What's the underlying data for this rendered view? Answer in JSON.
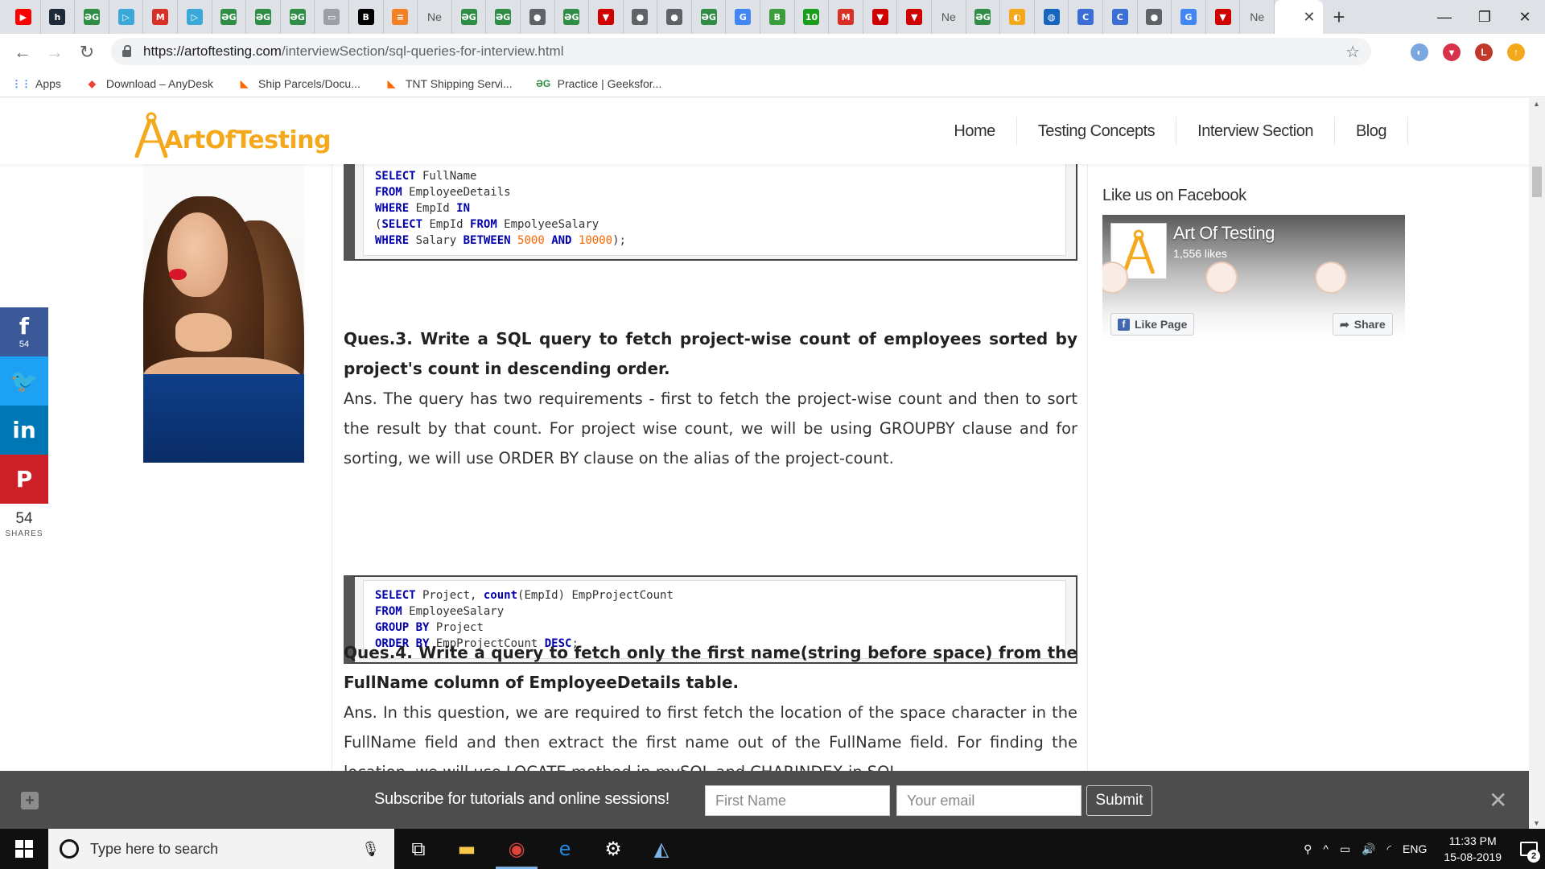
{
  "browser": {
    "tabs": [
      {
        "icon": "youtube-icon",
        "glyph": "▶",
        "color": "#ff0000"
      },
      {
        "icon": "hackerrank-icon",
        "glyph": "h",
        "color": "#1d2a3a"
      },
      {
        "icon": "geeksforgeeks-icon",
        "glyph": "ƏG",
        "color": "#2f8d46"
      },
      {
        "icon": "media-icon",
        "glyph": "▷",
        "color": "#3aa8d8"
      },
      {
        "icon": "gmail-icon",
        "glyph": "M",
        "color": "#d93025"
      },
      {
        "icon": "media-icon",
        "glyph": "▷",
        "color": "#3aa8d8"
      },
      {
        "icon": "geeksforgeeks-icon",
        "glyph": "ƏG",
        "color": "#2f8d46"
      },
      {
        "icon": "geeksforgeeks-icon",
        "glyph": "ƏG",
        "color": "#2f8d46"
      },
      {
        "icon": "geeksforgeeks-icon",
        "glyph": "ƏG",
        "color": "#2f8d46"
      },
      {
        "icon": "image-icon",
        "glyph": "▭",
        "color": "#9aa0a6"
      },
      {
        "icon": "bold-b-icon",
        "glyph": "B",
        "color": "#000000"
      },
      {
        "icon": "stackoverflow-icon",
        "glyph": "≡",
        "color": "#f48024"
      },
      {
        "icon": "new-tab-icon",
        "text": "Ne"
      },
      {
        "icon": "geeksforgeeks-icon",
        "glyph": "ƏG",
        "color": "#2f8d46"
      },
      {
        "icon": "geeksforgeeks-icon",
        "glyph": "ƏG",
        "color": "#2f8d46"
      },
      {
        "icon": "globe-icon",
        "glyph": "●",
        "color": "#5f6368"
      },
      {
        "icon": "geeksforgeeks-icon",
        "glyph": "ƏG",
        "color": "#2f8d46"
      },
      {
        "icon": "vivaldi-icon",
        "glyph": "▼",
        "color": "#d00000"
      },
      {
        "icon": "globe-icon",
        "glyph": "●",
        "color": "#5f6368"
      },
      {
        "icon": "globe-icon",
        "glyph": "●",
        "color": "#5f6368"
      },
      {
        "icon": "geeksforgeeks-icon",
        "glyph": "ƏG",
        "color": "#2f8d46"
      },
      {
        "icon": "google-icon",
        "glyph": "G",
        "color": "#4285f4"
      },
      {
        "icon": "b-green-icon",
        "glyph": "B",
        "color": "#3b9d3b"
      },
      {
        "icon": "ten-icon",
        "glyph": "10",
        "color": "#1a9e1a"
      },
      {
        "icon": "gmail-icon",
        "glyph": "M",
        "color": "#d93025"
      },
      {
        "icon": "vivaldi-icon",
        "glyph": "▼",
        "color": "#d00000"
      },
      {
        "icon": "vivaldi-icon",
        "glyph": "▼",
        "color": "#d00000"
      },
      {
        "icon": "new-tab-icon",
        "text": "Ne"
      },
      {
        "icon": "geeksforgeeks-icon",
        "glyph": "ƏG",
        "color": "#2f8d46"
      },
      {
        "icon": "chrome-web-icon",
        "glyph": "◐",
        "color": "#f4a81b"
      },
      {
        "icon": "earth-icon",
        "glyph": "◍",
        "color": "#1565c0"
      },
      {
        "icon": "c-circle-icon",
        "glyph": "C",
        "color": "#3b6fd6"
      },
      {
        "icon": "c-circle-icon",
        "glyph": "C",
        "color": "#3b6fd6"
      },
      {
        "icon": "globe-icon",
        "glyph": "●",
        "color": "#5f6368"
      },
      {
        "icon": "google-icon",
        "glyph": "G",
        "color": "#4285f4"
      },
      {
        "icon": "vivaldi-icon",
        "glyph": "▼",
        "color": "#d00000"
      },
      {
        "icon": "new-tab-icon",
        "text": "Ne"
      }
    ],
    "active_tab_close": "✕",
    "new_tab": "+",
    "window_controls": {
      "minimize": "—",
      "restore": "❐",
      "close": "✕"
    },
    "nav": {
      "back": "←",
      "forward": "→",
      "reload": "↻"
    },
    "url_host": "https://artoftesting.com",
    "url_path": "/interviewSection/sql-queries-for-interview.html",
    "bookmark_star": "☆",
    "extensions": [
      {
        "icon": "extension-blue-icon",
        "glyph": "◐",
        "color": "#7aa7e0"
      },
      {
        "icon": "pocket-icon",
        "glyph": "▾",
        "color": "#d6324a"
      },
      {
        "icon": "profile-avatar-icon",
        "glyph": "L",
        "color": "#c0392b"
      },
      {
        "icon": "update-icon",
        "glyph": "↑",
        "color": "#f4a81b"
      }
    ],
    "bookmarks": [
      {
        "icon": "apps-grid-icon",
        "glyph": "⋮⋮",
        "color": "#4285f4",
        "label": "Apps"
      },
      {
        "icon": "anydesk-icon",
        "glyph": "◆",
        "color": "#ef443b",
        "label": "Download – AnyDesk"
      },
      {
        "icon": "shipping-icon",
        "glyph": "◣",
        "color": "#ff6600",
        "label": "Ship Parcels/Docu..."
      },
      {
        "icon": "shipping-icon",
        "glyph": "◣",
        "color": "#ff6600",
        "label": "TNT Shipping Servi..."
      },
      {
        "icon": "geeksforgeeks-icon",
        "glyph": "ƏG",
        "color": "#2f8d46",
        "label": "Practice | Geeksfor..."
      }
    ]
  },
  "site": {
    "logo_text": "ArtOfTesting",
    "nav": [
      "Home",
      "Testing Concepts",
      "Interview Section",
      "Blog"
    ],
    "accent": "#f4a81b"
  },
  "share": {
    "buttons": [
      {
        "icon": "facebook-icon",
        "glyph": "f",
        "color": "#3b5998",
        "count": "54"
      },
      {
        "icon": "twitter-icon",
        "glyph": "🐦",
        "color": "#1da1f2",
        "count": ""
      },
      {
        "icon": "linkedin-icon",
        "glyph": "in",
        "color": "#0077b5",
        "count": ""
      },
      {
        "icon": "pinterest-icon",
        "glyph": "P",
        "color": "#cb2027",
        "count": ""
      }
    ],
    "total": "54",
    "label": "SHARES"
  },
  "content": {
    "code1": [
      [
        {
          "t": "SELECT",
          "k": "kw"
        },
        {
          "t": " FullName"
        }
      ],
      [
        {
          "t": "FROM",
          "k": "kw"
        },
        {
          "t": " EmployeeDetails"
        }
      ],
      [
        {
          "t": "WHERE",
          "k": "kw"
        },
        {
          "t": " EmpId "
        },
        {
          "t": "IN",
          "k": "kw"
        }
      ],
      [
        {
          "t": "("
        },
        {
          "t": "SELECT",
          "k": "kw"
        },
        {
          "t": " EmpId "
        },
        {
          "t": "FROM",
          "k": "kw"
        },
        {
          "t": " EmpolyeeSalary"
        }
      ],
      [
        {
          "t": "WHERE",
          "k": "kw"
        },
        {
          "t": " Salary "
        },
        {
          "t": "BETWEEN",
          "k": "kw"
        },
        {
          "t": " "
        },
        {
          "t": "5000",
          "k": "num"
        },
        {
          "t": " "
        },
        {
          "t": "AND",
          "k": "kw"
        },
        {
          "t": " "
        },
        {
          "t": "10000",
          "k": "num"
        },
        {
          "t": ");"
        }
      ]
    ],
    "q3_title": "Ques.3. Write a SQL query to fetch project-wise count of employees sorted by project's count in descending order.",
    "q3_answer": "Ans. The query has two requirements - first to fetch the project-wise count and then to sort the result by that count. For project wise count, we will be using GROUPBY clause and for sorting, we will use ORDER BY clause on the alias of the project-count.",
    "code2": [
      [
        {
          "t": "SELECT",
          "k": "kw"
        },
        {
          "t": " Project, "
        },
        {
          "t": "count",
          "k": "kw"
        },
        {
          "t": "(EmpId) EmpProjectCount"
        }
      ],
      [
        {
          "t": "FROM",
          "k": "kw"
        },
        {
          "t": " EmployeeSalary"
        }
      ],
      [
        {
          "t": "GROUP",
          "k": "kw"
        },
        {
          "t": " "
        },
        {
          "t": "BY",
          "k": "kw"
        },
        {
          "t": " Project"
        }
      ],
      [
        {
          "t": "ORDER",
          "k": "kw"
        },
        {
          "t": " "
        },
        {
          "t": "BY",
          "k": "kw"
        },
        {
          "t": " EmpProjectCount "
        },
        {
          "t": "DESC",
          "k": "kw"
        },
        {
          "t": ";"
        }
      ]
    ],
    "q4_title": "Ques.4. Write a query to fetch only the first name(string before space) from the FullName column of EmployeeDetails table.",
    "q4_answer": "Ans. In this question, we are required to first fetch the location of the space character in the FullName field and then extract the first name out of the FullName field. For finding the location, we will use LOCATE method in mySQL and CHARINDEX in SQL"
  },
  "sidebar": {
    "heading": "Like us on Facebook",
    "fb_page_name": "Art Of Testing",
    "fb_likes": "1,556 likes",
    "fb_like_button": "Like Page",
    "fb_share_button": "Share"
  },
  "subscribe": {
    "message": "Subscribe for tutorials and online sessions!",
    "first_name_placeholder": "First Name",
    "email_placeholder": "Your email",
    "submit_label": "Submit",
    "plus_glyph": "+",
    "close_glyph": "✕"
  },
  "taskbar": {
    "search_placeholder": "Type here to search",
    "apps": [
      {
        "icon": "task-view-icon",
        "glyph": "⧉",
        "color": "#ffffff",
        "active": false
      },
      {
        "icon": "file-explorer-icon",
        "glyph": "▬",
        "color": "#f8c648",
        "active": false
      },
      {
        "icon": "chrome-icon",
        "glyph": "◉",
        "color": "#db4437",
        "active": true
      },
      {
        "icon": "edge-icon",
        "glyph": "e",
        "color": "#1e88e5",
        "active": false
      },
      {
        "icon": "settings-icon",
        "glyph": "⚙",
        "color": "#ffffff",
        "active": false
      },
      {
        "icon": "sql-server-icon",
        "glyph": "◭",
        "color": "#7fb2e5",
        "active": false
      }
    ],
    "tray_icons": [
      {
        "icon": "people-icon",
        "glyph": "⚲"
      },
      {
        "icon": "chevron-up-icon",
        "glyph": "^"
      },
      {
        "icon": "battery-icon",
        "glyph": "▭"
      },
      {
        "icon": "volume-icon",
        "glyph": "🔊"
      },
      {
        "icon": "wifi-icon",
        "glyph": "◜"
      }
    ],
    "language": "ENG",
    "time": "11:33 PM",
    "date": "15-08-2019",
    "notifications": "2"
  }
}
